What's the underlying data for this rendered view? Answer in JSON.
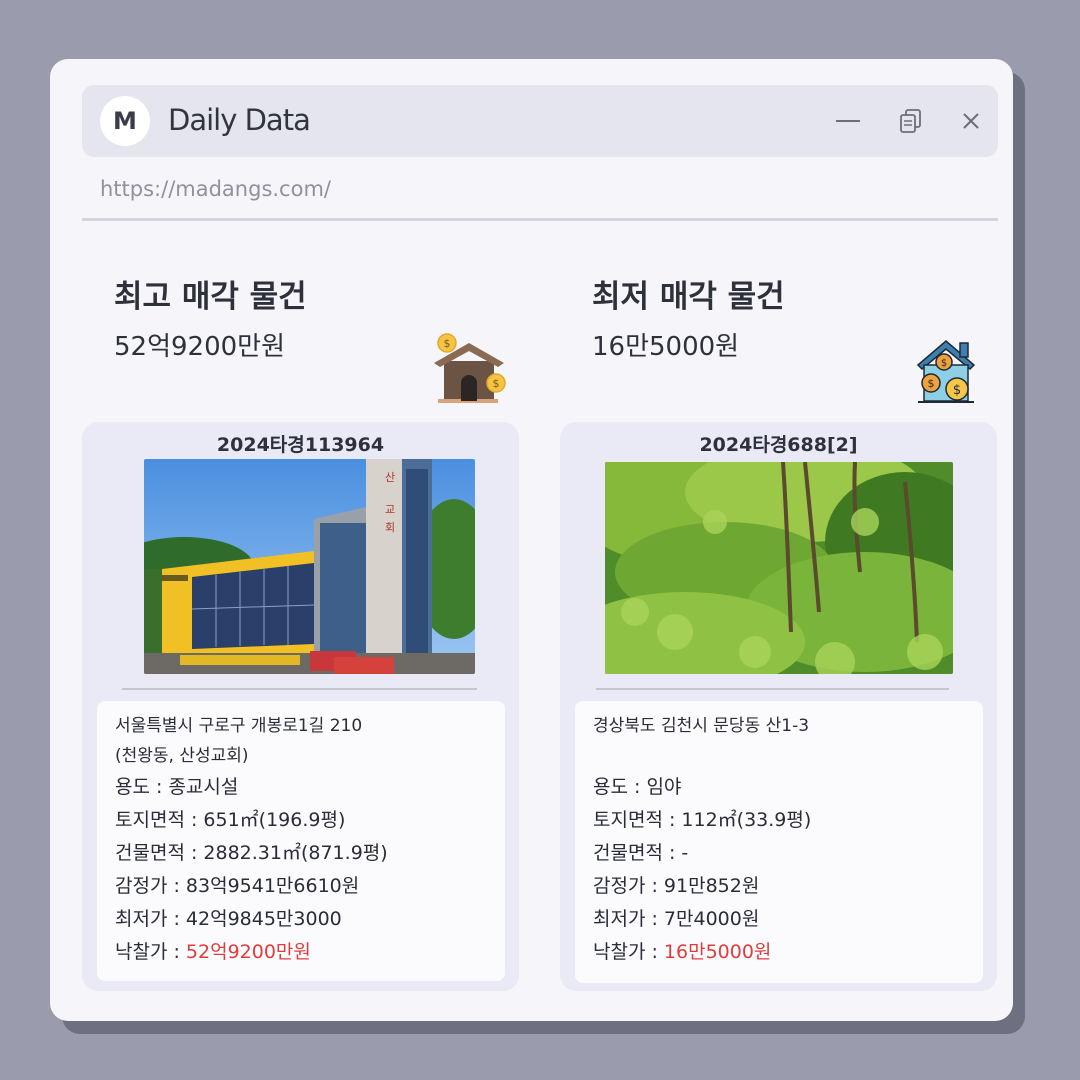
{
  "window": {
    "logo_letter": "M",
    "title": "Daily Data",
    "url": "https://madangs.com/"
  },
  "highest": {
    "heading": "최고 매각 물건",
    "amount": "52억9200만원",
    "icon": "house-with-coins-icon",
    "card": {
      "case_no": "2024타경113964",
      "photo": "church-building-photo",
      "address_line1": "서울특별시 구로구 개봉로1길 210",
      "address_line2": "(천왕동, 산성교회)",
      "usage": "용도 : 종교시설",
      "land_area": "토지면적 : 651㎡(196.9평)",
      "building_area": "건물면적 : 2882.31㎡(871.9평)",
      "appraisal": "감정가 : 83억9541만6610원",
      "minimum": "최저가 : 42억9845만3000",
      "winning_label": "낙찰가 : ",
      "winning_price": "52억9200만원"
    }
  },
  "lowest": {
    "heading": "최저 매각 물건",
    "amount": "16만5000원",
    "icon": "house-with-money-icon",
    "card": {
      "case_no": "2024타경688[2]",
      "photo": "forest-land-photo",
      "address_line1": "경상북도 김천시 문당동 산1-3",
      "usage": "용도 : 임야",
      "land_area": "토지면적 : 112㎡(33.9평)",
      "building_area": "건물면적 : -",
      "appraisal": "감정가 : 91만852원",
      "minimum": "최저가 : 7만4000원",
      "winning_label": "낙찰가 : ",
      "winning_price": "16만5000원"
    }
  },
  "colors": {
    "background": "#9a9cae",
    "window": "#f6f6fa",
    "titlebar": "#e4e5ee",
    "card": "#e9eaf5",
    "price_highlight": "#e03c3c"
  }
}
